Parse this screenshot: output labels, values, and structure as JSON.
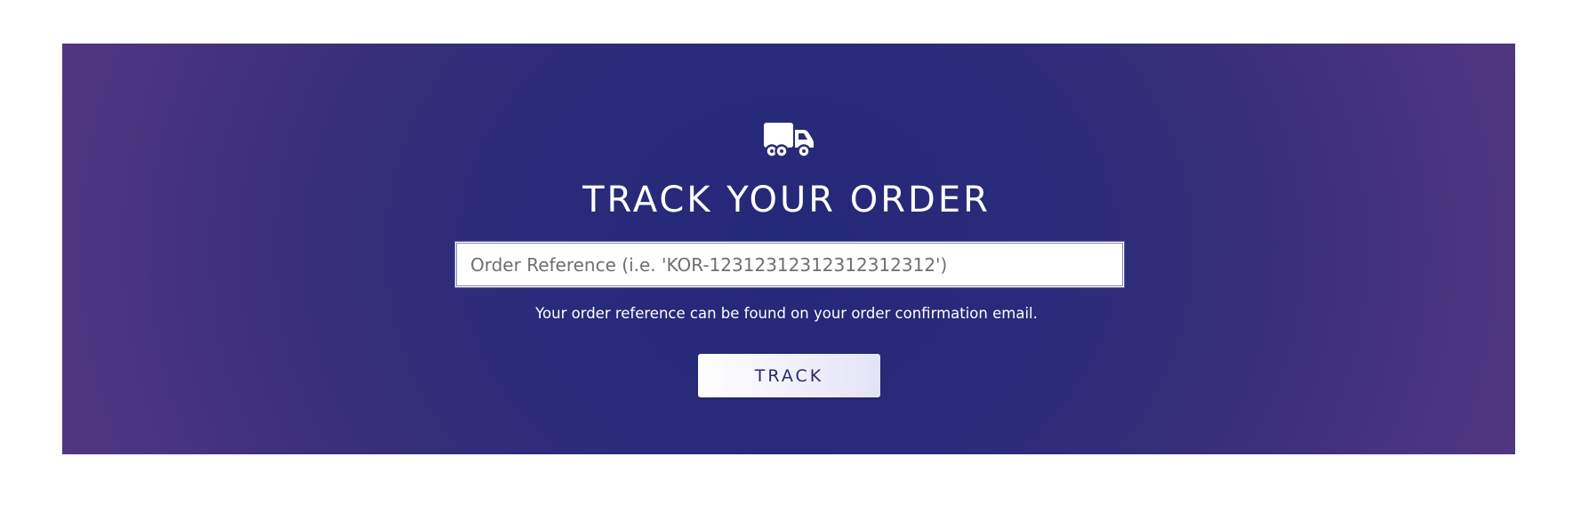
{
  "banner": {
    "background_colors": [
      "#232878",
      "#5b3b85"
    ]
  },
  "icon": {
    "name": "truck-icon",
    "color": "#ffffff"
  },
  "title": "TRACK YOUR ORDER",
  "search": {
    "value": "",
    "placeholder": "Order Reference (i.e. 'KOR-12312312312312312312')"
  },
  "hint": "Your order reference can be found on your order confirmation email.",
  "button": {
    "label": "TRACK",
    "text_color": "#262a6e"
  }
}
